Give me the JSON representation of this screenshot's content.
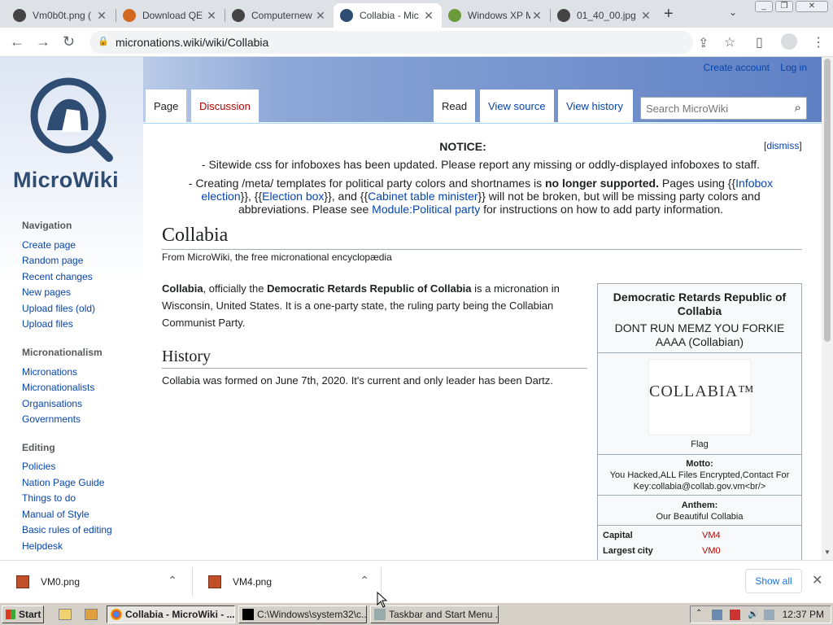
{
  "browser": {
    "tabs": [
      {
        "label": "Vm0b0t.png (",
        "favicon": "wiki-icon"
      },
      {
        "label": "Download QE",
        "favicon": "firefox-icon"
      },
      {
        "label": "Computernew",
        "favicon": "wiki-icon"
      },
      {
        "label": "Collabia - Mic",
        "favicon": "wiki-icon",
        "active": true
      },
      {
        "label": "Windows XP M",
        "favicon": "xp-icon"
      },
      {
        "label": "01_40_00.jpg",
        "favicon": "wiki-icon"
      }
    ],
    "url": "micronations.wiki/wiki/Collabia"
  },
  "site": {
    "logo_text": "MicroWiki",
    "personal": {
      "create_account": "Create account",
      "log_in": "Log in"
    },
    "tabs": {
      "page": "Page",
      "discussion": "Discussion",
      "read": "Read",
      "view_source": "View source",
      "view_history": "View history"
    },
    "search_placeholder": "Search MicroWiki",
    "sidebar": {
      "navigation": {
        "heading": "Navigation",
        "items": [
          "Create page",
          "Random page",
          "Recent changes",
          "New pages",
          "Upload files (old)",
          "Upload files"
        ]
      },
      "micronationalism": {
        "heading": "Micronationalism",
        "items": [
          "Micronations",
          "Micronationalists",
          "Organisations",
          "Governments"
        ]
      },
      "editing": {
        "heading": "Editing",
        "items": [
          "Policies",
          "Nation Page Guide",
          "Things to do",
          "Manual of Style",
          "Basic rules of editing",
          "Helpdesk"
        ]
      }
    }
  },
  "notice": {
    "title": "NOTICE:",
    "dismiss_open": "[",
    "dismiss": "dismiss",
    "dismiss_close": "]",
    "line1": "- Sitewide css for infoboxes has been updated. Please report any missing or oddly-displayed infoboxes to staff.",
    "line2_a": "- Creating /meta/ templates for political party colors and shortnames is ",
    "line2_bold": "no longer supported.",
    "line2_b": " Pages using {{",
    "line2_link1a": "Infobox",
    "line2_link1b": "election",
    "line2_c": "}}, {{",
    "line2_link2": "Election box",
    "line2_d": "}}, and {{",
    "line2_link3": "Cabinet table minister",
    "line2_e": "}} will not be broken, but will be missing party colors and",
    "line2_f": "abbreviations. Please see ",
    "line2_link4": "Module:Political party",
    "line2_g": " for instructions on how to add party information."
  },
  "article": {
    "title": "Collabia",
    "tagline": "From MicroWiki, the free micronational encyclopædia",
    "lead_b1": "Collabia",
    "lead_t1": ", officially the ",
    "lead_b2": "Democratic Retards Republic of Collabia",
    "lead_t2": " is a micronation in Wisconsin, United States. It is a one-party state, the ruling party being the Collabian Communist Party.",
    "history_heading": "History",
    "history_text": "Collabia was formed on June 7th, 2020. It's current and only leader has been Dartz."
  },
  "infobox": {
    "title": "Democratic Retards Republic of Collabia",
    "subtitle": "DONT RUN MEMZ YOU FORKIE AAAA (Collabian)",
    "flag_text": "COLLABIA™",
    "flag_caption": "Flag",
    "motto_label": "Motto:",
    "motto_text": "You Hacked,ALL Files Encrypted,Contact For Key:collabia@collab.gov.vm<br/>",
    "anthem_label": "Anthem:",
    "anthem_text": "Our Beautiful Collabia",
    "rows": [
      {
        "label": "Capital",
        "value": "VM4"
      },
      {
        "label": "Largest city",
        "value": "VM0"
      }
    ]
  },
  "downloads": {
    "items": [
      "VM0.png",
      "VM4.png"
    ],
    "show_all": "Show all"
  },
  "taskbar": {
    "start": "Start",
    "buttons": [
      "Collabia - MicroWiki - ...",
      "C:\\Windows\\system32\\c...",
      "Taskbar and Start Menu ..."
    ],
    "clock": "12:37 PM"
  },
  "colors": {
    "link": "#0645ad",
    "redlink": "#ba0000",
    "logo": "#2f4c73"
  }
}
